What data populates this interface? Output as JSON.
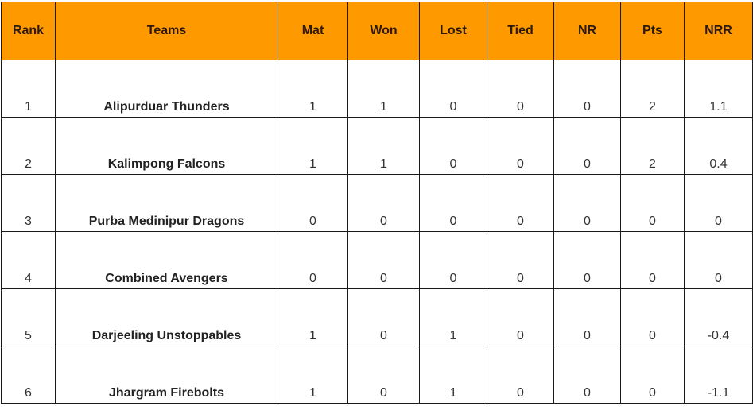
{
  "colors": {
    "header_bg": "#ff9900",
    "header_text": "#2b1a0a",
    "border": "#1a1a1a",
    "cell_text": "#333333"
  },
  "table": {
    "headers": [
      "Rank",
      "Teams",
      "Mat",
      "Won",
      "Lost",
      "Tied",
      "NR",
      "Pts",
      "NRR"
    ],
    "rows": [
      [
        "1",
        "Alipurduar Thunders",
        "1",
        "1",
        "0",
        "0",
        "0",
        "2",
        "1.1"
      ],
      [
        "2",
        "Kalimpong Falcons",
        "1",
        "1",
        "0",
        "0",
        "0",
        "2",
        "0.4"
      ],
      [
        "3",
        "Purba Medinipur Dragons",
        "0",
        "0",
        "0",
        "0",
        "0",
        "0",
        "0"
      ],
      [
        "4",
        "Combined Avengers",
        "0",
        "0",
        "0",
        "0",
        "0",
        "0",
        "0"
      ],
      [
        "5",
        "Darjeeling Unstoppables",
        "1",
        "0",
        "1",
        "0",
        "0",
        "0",
        "-0.4"
      ],
      [
        "6",
        "Jhargram Firebolts",
        "1",
        "0",
        "1",
        "0",
        "0",
        "0",
        "-1.1"
      ]
    ]
  }
}
